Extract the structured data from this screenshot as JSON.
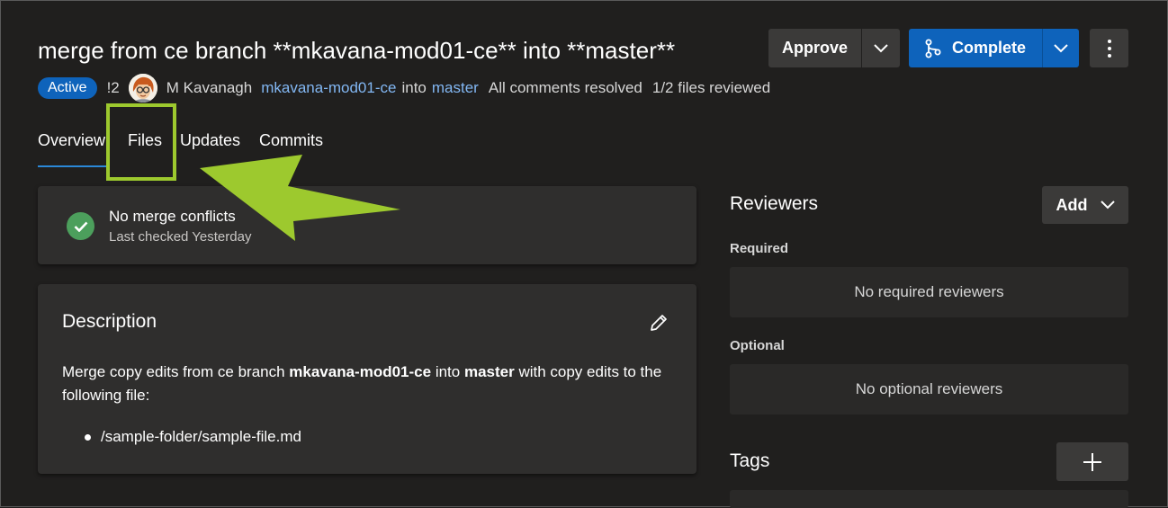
{
  "pr": {
    "title": "merge from ce branch **mkavana-mod01-ce** into **master**",
    "status_badge": "Active",
    "id": "!2",
    "author": "M Kavanagh",
    "source_branch": "mkavana-mod01-ce",
    "into_word": "into",
    "target_branch": "master",
    "comments_status": "All comments resolved",
    "files_reviewed": "1/2 files reviewed"
  },
  "actions": {
    "approve_label": "Approve",
    "complete_label": "Complete"
  },
  "tabs": [
    {
      "label": "Overview",
      "active": true
    },
    {
      "label": "Files",
      "active": false
    },
    {
      "label": "Updates",
      "active": false
    },
    {
      "label": "Commits",
      "active": false
    }
  ],
  "merge_status": {
    "title": "No merge conflicts",
    "subtitle": "Last checked Yesterday"
  },
  "description": {
    "heading": "Description",
    "text_before": "Merge copy edits from ce branch ",
    "bold_branch": "mkavana-mod01-ce",
    "text_mid": " into ",
    "bold_target": "master",
    "text_after": " with copy edits to the following file:",
    "files": [
      "/sample-folder/sample-file.md"
    ]
  },
  "reviewers": {
    "heading": "Reviewers",
    "add_label": "Add",
    "required_label": "Required",
    "required_empty": "No required reviewers",
    "optional_label": "Optional",
    "optional_empty": "No optional reviewers"
  },
  "tags": {
    "heading": "Tags"
  },
  "icons": {
    "approve_dropdown": "chevron-down-icon",
    "complete": "branch-merge-icon",
    "more": "more-vertical-icon",
    "check": "check-circle-icon",
    "edit": "pencil-icon",
    "add_tag": "plus-icon",
    "callout": "arrow-callout"
  },
  "colors": {
    "accent": "#0e63bb",
    "link": "#82b7f3",
    "success": "#4c9f5c",
    "highlight": "#9dc92e"
  }
}
